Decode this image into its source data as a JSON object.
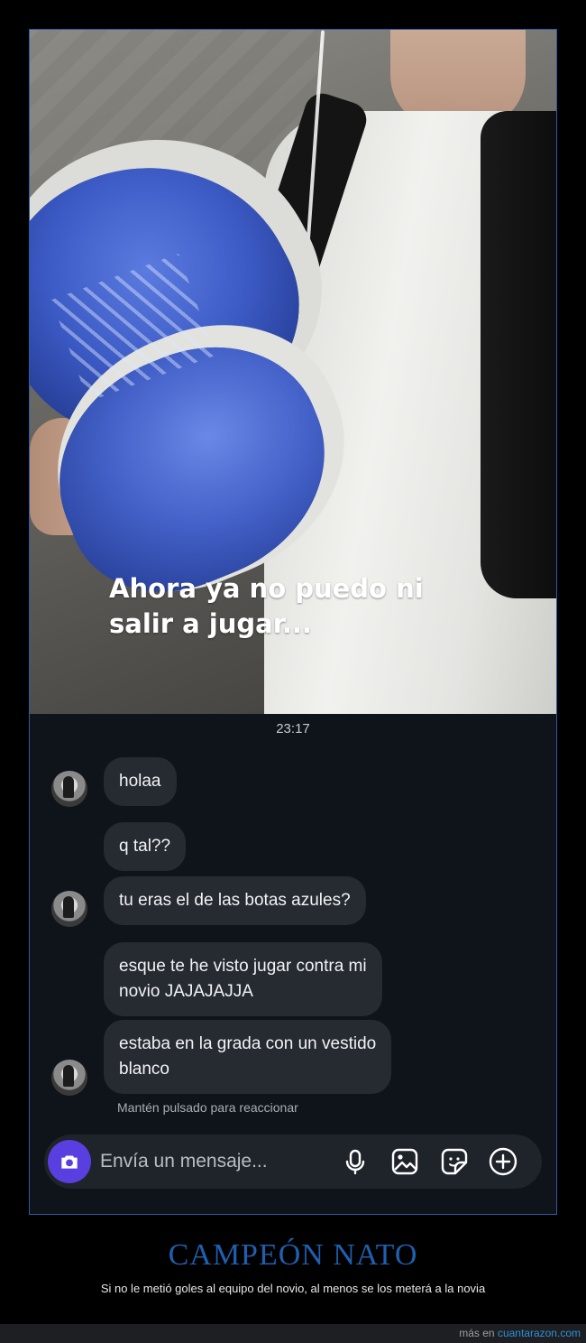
{
  "story": {
    "caption_line1": "Ahora ya no puedo ni",
    "caption_line2": "salir a jugar..."
  },
  "chat": {
    "timestamp": "23:17",
    "messages": [
      {
        "text": "holaa",
        "has_avatar": true
      },
      {
        "text": "q tal??",
        "has_avatar": false
      },
      {
        "text": "tu eras el de las botas azules?",
        "has_avatar": true
      },
      {
        "line1": "esque te he visto jugar contra mi",
        "line2": "novio JAJAJAJJA",
        "has_avatar": false
      },
      {
        "line1": "estaba en la grada con un vestido",
        "line2": "blanco",
        "has_avatar": true
      }
    ],
    "reaction_hint": "Mantén pulsado para reaccionar"
  },
  "composer": {
    "placeholder": "Envía un mensaje...",
    "icons": [
      "camera-icon",
      "microphone-icon",
      "gallery-icon",
      "sticker-icon",
      "plus-icon"
    ],
    "camera_color": "#5a3fe0"
  },
  "post": {
    "title": "CAMPEÓN NATO",
    "subtitle": "Si no le metió goles al equipo del novio, al menos se los meterá a la novia"
  },
  "footer": {
    "prefix": "más en",
    "site": "cuantarazon.com"
  },
  "colors": {
    "title": "#1f5fae",
    "frame_border": "#2b5aa8",
    "chat_bg": "#0f141b",
    "bubble_bg": "#262a31",
    "link": "#2f8fd8"
  }
}
